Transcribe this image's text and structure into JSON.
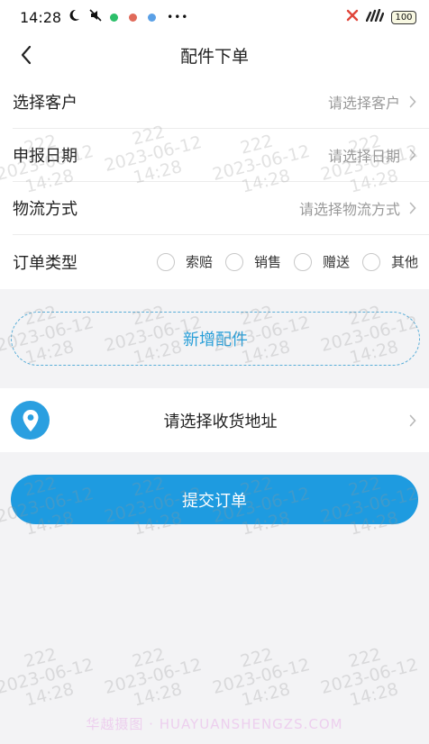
{
  "status_bar": {
    "time": "14:28",
    "battery": "100",
    "icons": [
      "moon-icon",
      "mute-icon",
      "app-notification-icons",
      "more-dots-icon",
      "no-sim-icon",
      "signal-icon",
      "battery-icon"
    ],
    "more": "•••"
  },
  "nav": {
    "title": "配件下单",
    "back_icon": "chevron-left-icon"
  },
  "form": {
    "customer": {
      "label": "选择客户",
      "placeholder": "请选择客户"
    },
    "date": {
      "label": "申报日期",
      "placeholder": "请选择日期"
    },
    "logistics": {
      "label": "物流方式",
      "placeholder": "请选择物流方式"
    },
    "order_type": {
      "label": "订单类型",
      "options": [
        "索赔",
        "销售",
        "赠送",
        "其他"
      ],
      "selected": null
    }
  },
  "add_part": {
    "label": "新增配件"
  },
  "address": {
    "label": "请选择收货地址",
    "icon": "location-pin-icon"
  },
  "submit": {
    "label": "提交订单"
  },
  "watermark": {
    "user": "222",
    "date": "2023-06-12",
    "time": "14:28"
  },
  "footer_watermark": "华越摄图 · HUAYUANSHENGZS.COM",
  "colors": {
    "accent": "#1e9be0",
    "dashed_border": "#5aaed8",
    "background": "#f3f3f5"
  }
}
